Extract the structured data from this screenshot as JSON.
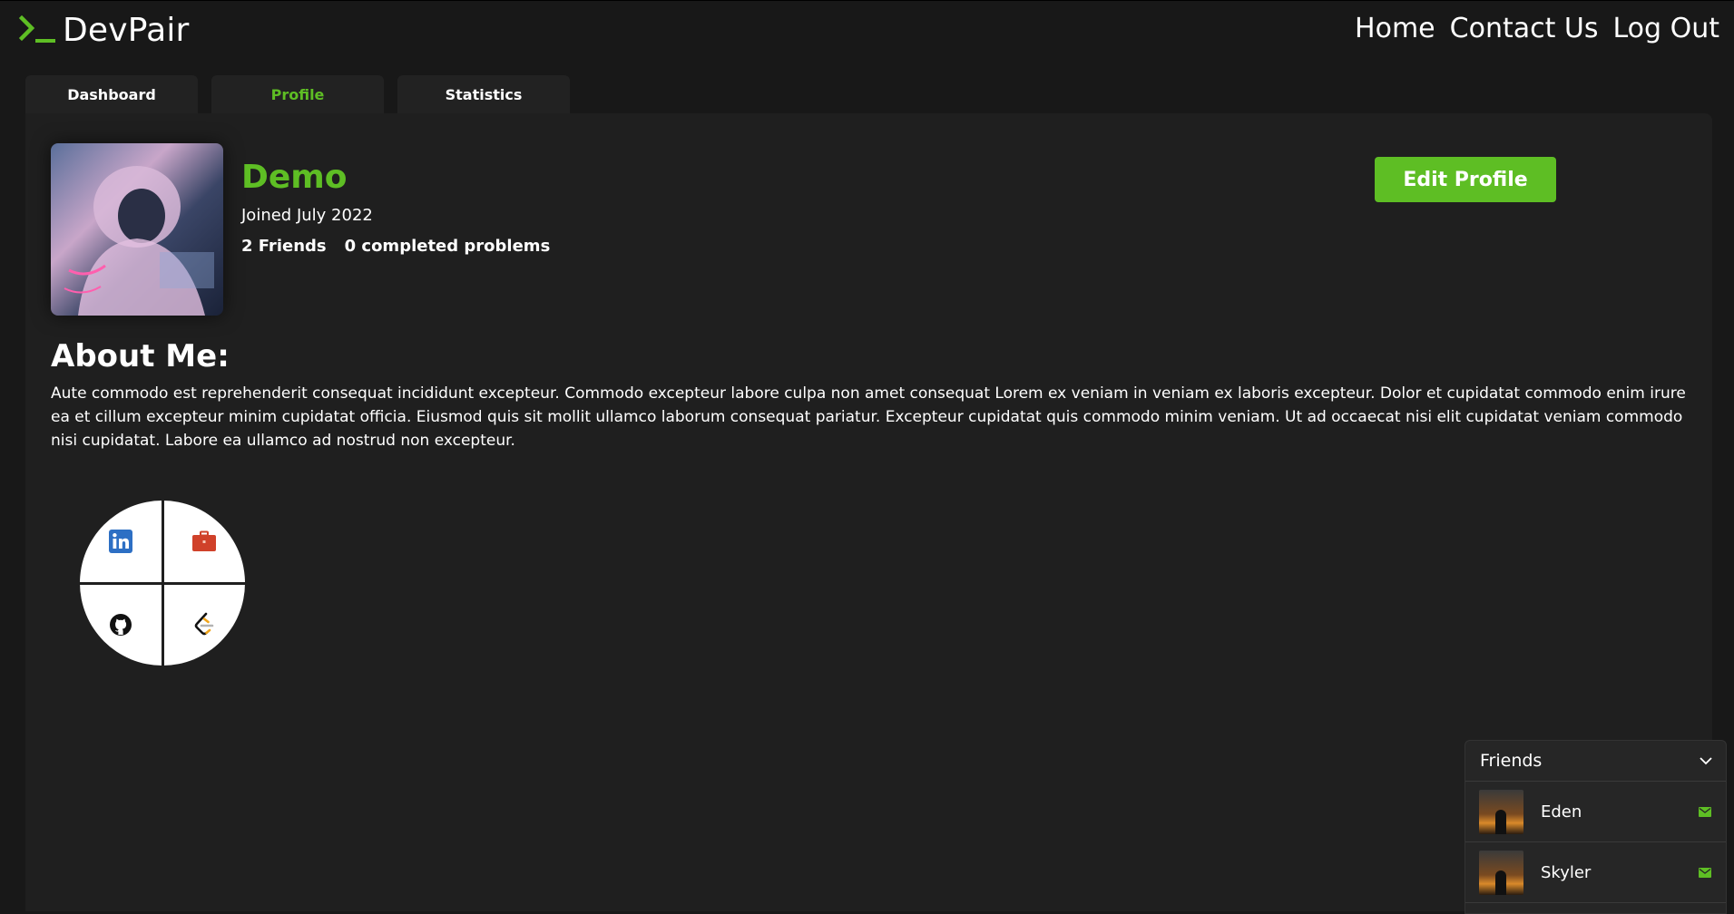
{
  "brand": {
    "name": "DevPair",
    "accent": "#5ebe24"
  },
  "nav": {
    "items": [
      "Home",
      "Contact Us",
      "Log Out"
    ]
  },
  "tabs": [
    {
      "label": "Dashboard",
      "active": false
    },
    {
      "label": "Profile",
      "active": true
    },
    {
      "label": "Statistics",
      "active": false
    }
  ],
  "profile": {
    "name": "Demo",
    "joined": "Joined July 2022",
    "friends_count": "2 Friends",
    "problems": "0 completed problems",
    "edit_label": "Edit Profile"
  },
  "about": {
    "title": "About Me:",
    "text": "Aute commodo est reprehenderit consequat incididunt excepteur. Commodo excepteur labore culpa non amet consequat Lorem ex veniam in veniam ex laboris excepteur. Dolor et cupidatat commodo enim irure ea et cillum excepteur minim cupidatat officia. Eiusmod quis sit mollit ullamco laborum consequat pariatur. Excepteur cupidatat quis commodo minim veniam. Ut ad occaecat nisi elit cupidatat veniam commodo nisi cupidatat. Labore ea ullamco ad nostrud non excepteur."
  },
  "socials": [
    {
      "icon": "linkedin-icon"
    },
    {
      "icon": "portfolio-icon"
    },
    {
      "icon": "github-icon"
    },
    {
      "icon": "leetcode-icon"
    }
  ],
  "friends_panel": {
    "title": "Friends",
    "friends": [
      {
        "name": "Eden"
      },
      {
        "name": "Skyler"
      }
    ]
  }
}
